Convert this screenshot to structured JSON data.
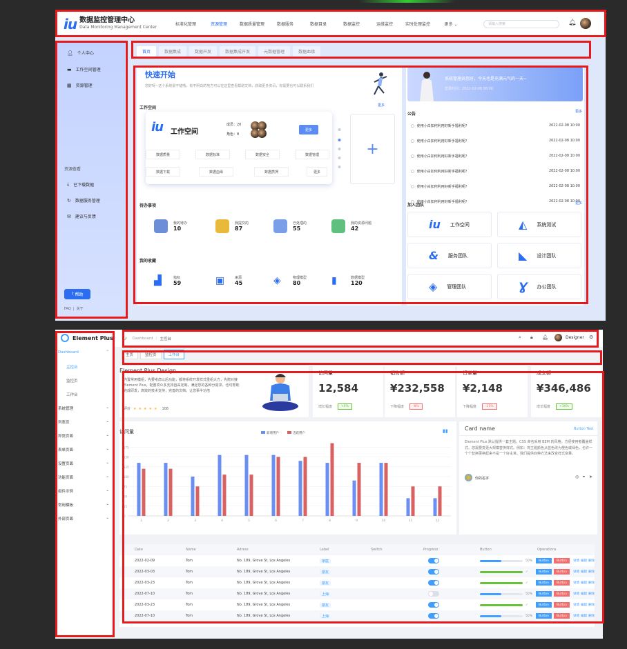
{
  "s1": {
    "brand_title": "数据监控管理中心",
    "brand_sub": "Data Monitoring Management Center",
    "nav": [
      "标准化管理",
      "资源管理",
      "数据质量管理",
      "数据服务",
      "数据目录",
      "数据监控",
      "运维监控",
      "实时处理监控",
      "更多 ⌄"
    ],
    "search_placeholder": "请输入搜索",
    "side_top": [
      "个人中心",
      "工作空间管理",
      "资源管理"
    ],
    "side_section": "资源查看",
    "side_bottom": [
      "已下载数据",
      "数据服务管理",
      "建议与反馈"
    ],
    "help": "帮助",
    "footer_links": "FAQ  |  关于",
    "tabs": [
      "首页",
      "数据集成",
      "数据开发",
      "数据集成开发",
      "元数据管理",
      "数据血缘"
    ],
    "quick_title": "快速开始",
    "quick_desc": "您好呀~这个系统很不错哦，有不明白的地方可以在这里查看帮助文档，获取更多资讯，有需要也可以联系我们",
    "banner_title": "系统管理员您好，今天也是充满元气的一天~",
    "banner_date": "登录时间：2022-02-08 08:00",
    "workspace_label": "工作空间",
    "more": "更多",
    "ws_name": "工作空间",
    "ws_members": "成员：20",
    "ws_roles": "角色：8",
    "ws_more": "更多",
    "ws_buttons": [
      "数据质量",
      "数据标准",
      "数据安全",
      "数据管理",
      "数据下载",
      "数据血缘",
      "数据质押",
      "更多"
    ],
    "notice_label": "公告",
    "notices": [
      {
        "t": "使用小白如何利用好新手福利呢?",
        "d": "2022-02-08 10:00"
      },
      {
        "t": "使用小白如何利用好新手福利呢?",
        "d": "2022-02-08 10:00"
      },
      {
        "t": "使用小白如何利用好新手福利呢?",
        "d": "2022-02-08 10:00"
      },
      {
        "t": "使用小白如何利用好新手福利呢?",
        "d": "2022-02-08 10:00"
      },
      {
        "t": "使用小白如何利用好新手福利呢?",
        "d": "2022-02-08 10:00"
      },
      {
        "t": "使用小白如何利用好新手福利呢?",
        "d": "2022-02-08 10:00"
      }
    ],
    "todo_label": "待办事项",
    "todos": [
      {
        "l": "我的待办",
        "v": "10"
      },
      {
        "l": "我提交的",
        "v": "87"
      },
      {
        "l": "已处理的",
        "v": "55"
      },
      {
        "l": "我的资源问题",
        "v": "42"
      }
    ],
    "fav_label": "我的收藏",
    "favs": [
      {
        "l": "指标",
        "v": "59"
      },
      {
        "l": "来源",
        "v": "45"
      },
      {
        "l": "物理模型",
        "v": "80"
      },
      {
        "l": "数据模型",
        "v": "120"
      }
    ],
    "join_label": "加入团队",
    "teams": [
      "工作空间",
      "系统测试",
      "服务团队",
      "设计团队",
      "管理团队",
      "办公团队"
    ]
  },
  "s2": {
    "brand": "Element Plus",
    "menu": [
      {
        "l": "Dashboard",
        "c": "⌃",
        "cls": "act"
      },
      {
        "l": "主控台",
        "c": "",
        "cls": "sub act"
      },
      {
        "l": "监控页",
        "c": "",
        "cls": "sub"
      },
      {
        "l": "工作台",
        "c": "",
        "cls": "sub"
      },
      {
        "l": "系统管理",
        "c": "⌄",
        "cls": ""
      },
      {
        "l": "列表页",
        "c": "⌄",
        "cls": ""
      },
      {
        "l": "异常页面",
        "c": "⌄",
        "cls": ""
      },
      {
        "l": "表单页面",
        "c": "⌄",
        "cls": ""
      },
      {
        "l": "设置页面",
        "c": "⌄",
        "cls": ""
      },
      {
        "l": "功能页面",
        "c": "⌄",
        "cls": ""
      },
      {
        "l": "组件示例",
        "c": "⌄",
        "cls": ""
      },
      {
        "l": "常用模板",
        "c": "⌄",
        "cls": ""
      },
      {
        "l": "外部页面",
        "c": "⌄",
        "cls": ""
      }
    ],
    "breadcrumb": [
      "Dashboard",
      "主控台"
    ],
    "user": "Designer",
    "tabs": [
      "主页",
      "监控页",
      "工作台"
    ],
    "intro_title": "Element Plus Design",
    "intro_text": "内置常用模组，先要考虑以后功能，都将系统开发样式重组大方，先赠对接 Element Plus，配置项众多支持自由定制，满足您的各种分需求，也可帮助完成研发，高效的技术支持，完善的文档，让您事半功倍",
    "rating_label": "评价",
    "rating_value": "108",
    "kpis": [
      {
        "t": "访问量",
        "v": "12,584",
        "f": "增长幅度",
        "b": "+6%",
        "c": "#67c23a"
      },
      {
        "t": "销售额",
        "v": "¥232,558",
        "f": "下降幅度",
        "b": "-8%",
        "c": "#f56c6c"
      },
      {
        "t": "订单量",
        "v": "¥2,148",
        "f": "下降幅度",
        "b": "-15%",
        "c": "#f56c6c"
      },
      {
        "t": "成交额",
        "v": "¥346,486",
        "f": "增长幅度",
        "b": "+30%",
        "c": "#67c23a"
      }
    ],
    "chart_title": "访问量",
    "card_title": "Card name",
    "card_btn": "Button Text",
    "card_text": "Element Plus 默认提供一套主题，CSS 命名采用 BEM 的风格，方便使用者覆盖样式。您需要变更大规模替换样式。例如：将主题颜色从蓝色改为橙色或绿色，也许一个个替换更换起来不是一个好主意。我们提供四种方法来改变样式变量。",
    "card_user": "你的名字",
    "table_headers": [
      "Date",
      "Name",
      "Adress",
      "Label",
      "Switch",
      "Progress",
      "Button",
      "Operations"
    ],
    "rows": [
      {
        "date": "2022-02-09",
        "name": "Tom",
        "addr": "No. 189, Grove St, Los Angeles",
        "label": "家庭",
        "on": true,
        "p": 0.5,
        "pc": "#409eff",
        "pt": "50%"
      },
      {
        "date": "2022-03-03",
        "name": "Tom",
        "addr": "No. 189, Grove St, Los Angeles",
        "label": "朋友",
        "on": true,
        "p": 1,
        "pc": "#67c23a",
        "pt": "✓"
      },
      {
        "date": "2022-03-23",
        "name": "Tom",
        "addr": "No. 189, Grove St, Los Angeles",
        "label": "朋友",
        "on": true,
        "p": 1,
        "pc": "#67c23a",
        "pt": "✓"
      },
      {
        "date": "2022-07-10",
        "name": "Tom",
        "addr": "No. 189, Grove St, Los Angeles",
        "label": "上海",
        "on": false,
        "p": 0.5,
        "pc": "#409eff",
        "pt": "50%"
      },
      {
        "date": "2022-03-23",
        "name": "Tom",
        "addr": "No. 189, Grove St, Los Angeles",
        "label": "朋友",
        "on": true,
        "p": 1,
        "pc": "#67c23a",
        "pt": "✓"
      },
      {
        "date": "2022-07-10",
        "name": "Tom",
        "addr": "No. 189, Grove St, Los Angeles",
        "label": "上海",
        "on": true,
        "p": 0.5,
        "pc": "#409eff",
        "pt": "50%"
      }
    ],
    "btn1": "Button",
    "btn2": "Button",
    "ops": [
      "详情",
      "编辑",
      "删除"
    ],
    "chart_data": {
      "type": "bar",
      "title": "访问量",
      "categories": [
        "1",
        "2",
        "3",
        "4",
        "5",
        "6",
        "7",
        "8",
        "9",
        "10",
        "11",
        "12"
      ],
      "series": [
        {
          "name": "新增用户",
          "color": "#6b8ff0",
          "values": [
            135,
            135,
            100,
            155,
            155,
            155,
            140,
            135,
            90,
            135,
            45,
            45
          ]
        },
        {
          "name": "活跃用户",
          "color": "#d86262",
          "values": [
            120,
            120,
            75,
            105,
            105,
            150,
            150,
            185,
            135,
            135,
            75,
            75
          ]
        }
      ],
      "ylim": [
        0,
        200
      ],
      "yticks": [
        "0",
        "25",
        "50",
        "75",
        "100",
        "125",
        "150",
        "175"
      ]
    }
  }
}
